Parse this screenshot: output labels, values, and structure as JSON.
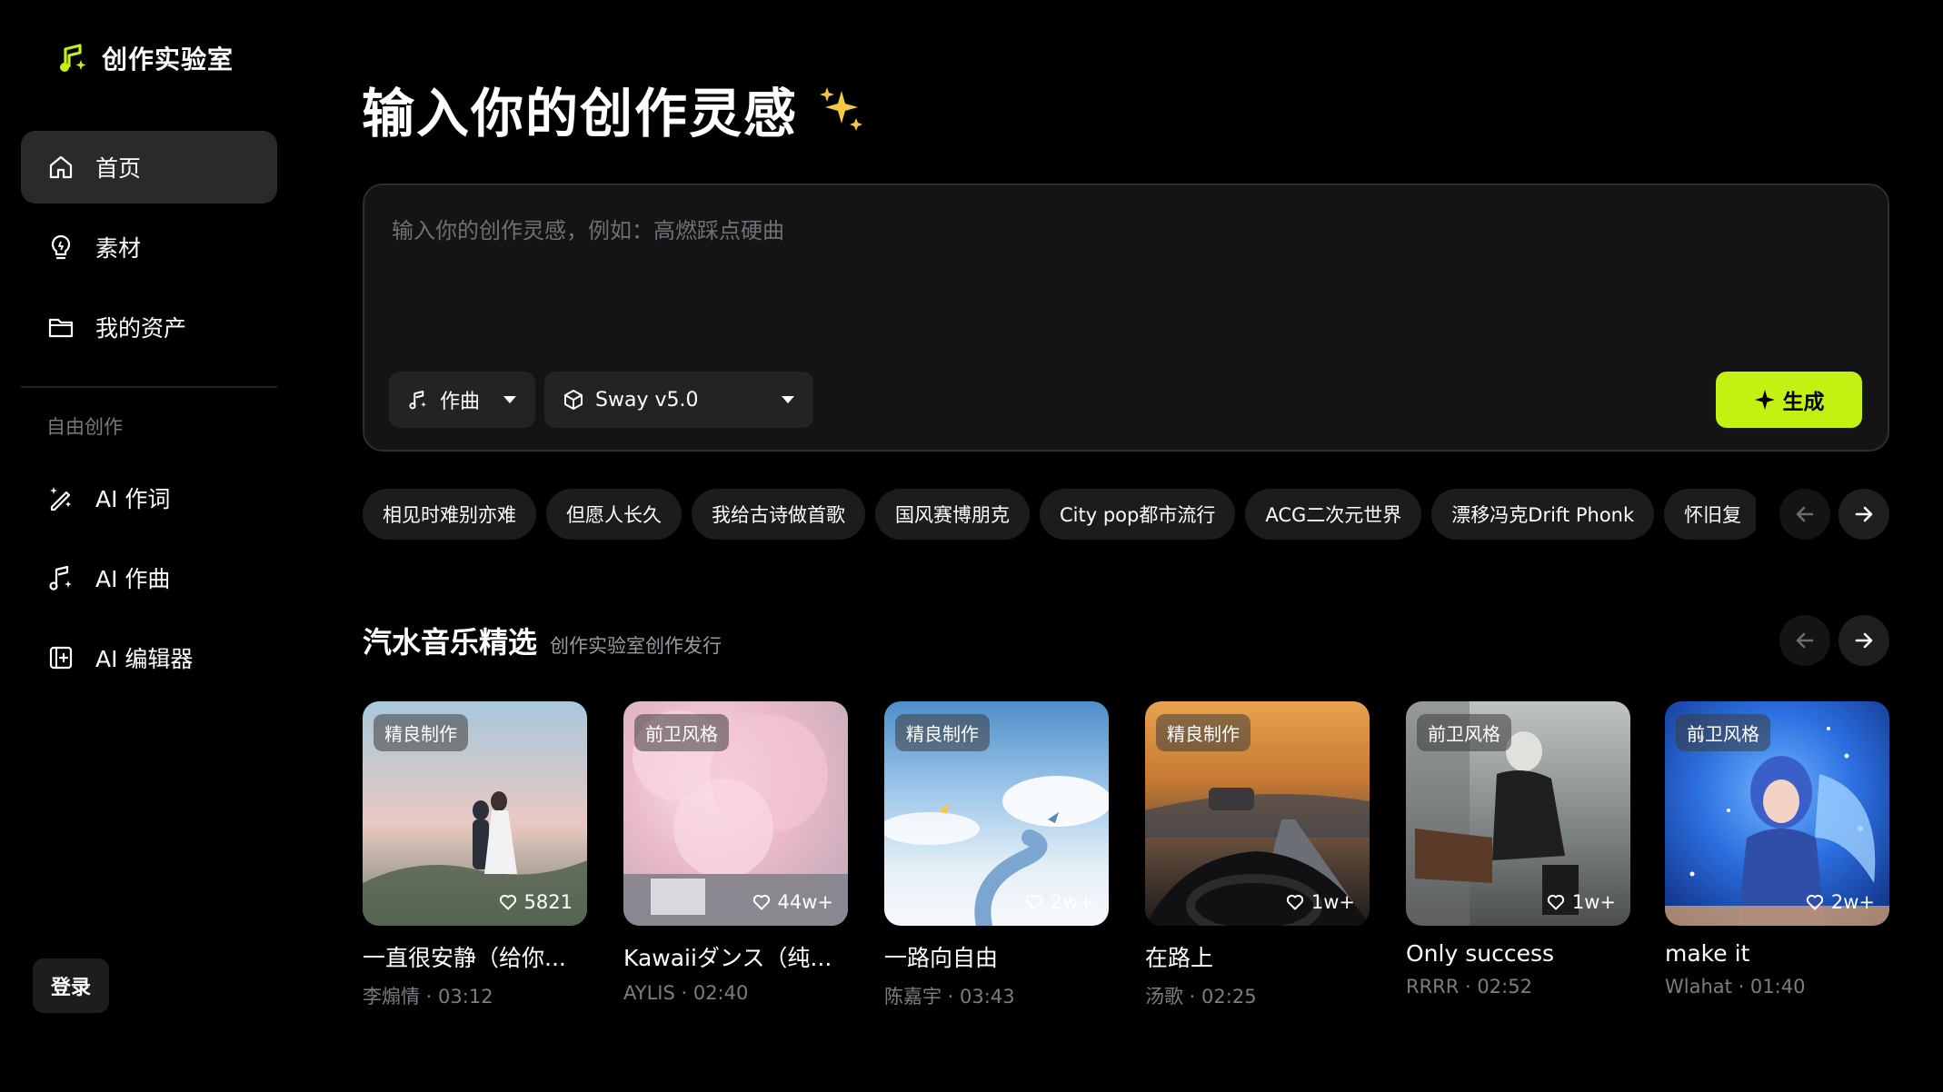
{
  "app": {
    "name": "创作实验室"
  },
  "sidebar": {
    "items": [
      {
        "label": "首页",
        "icon": "home-icon",
        "active": true
      },
      {
        "label": "素材",
        "icon": "bulb-icon",
        "active": false
      },
      {
        "label": "我的资产",
        "icon": "folder-icon",
        "active": false
      }
    ],
    "section_label": "自由创作",
    "tools": [
      {
        "label": "AI 作词",
        "icon": "magic-pen-icon"
      },
      {
        "label": "AI 作曲",
        "icon": "music-note-icon"
      },
      {
        "label": "AI 编辑器",
        "icon": "editor-icon"
      }
    ],
    "login_label": "登录"
  },
  "hero": {
    "title": "输入你的创作灵感",
    "sparkle": "sparkles-icon"
  },
  "composer": {
    "placeholder": "输入你的创作灵感，例如：高燃踩点硬曲",
    "value": "",
    "mode_select": "作曲",
    "model_select": "Sway v5.0",
    "generate_label": "生成"
  },
  "chips": [
    "相见时难别亦难",
    "但愿人长久",
    "我给古诗做首歌",
    "国风赛博朋克",
    "City pop都市流行",
    "ACG二次元世界",
    "漂移冯克Drift Phonk",
    "怀旧复"
  ],
  "featured": {
    "title": "汽水音乐精选",
    "subtitle": "创作实验室创作发行",
    "cards": [
      {
        "tag": "精良制作",
        "likes": "5821",
        "title": "一直很安静（给你...",
        "artist": "李煽情",
        "duration": "03:12"
      },
      {
        "tag": "前卫风格",
        "likes": "44w+",
        "title": "Kawaiiダンス（纯...",
        "artist": "AYLIS",
        "duration": "02:40"
      },
      {
        "tag": "精良制作",
        "likes": "2w+",
        "title": "一路向自由",
        "artist": "陈嘉宇",
        "duration": "03:43"
      },
      {
        "tag": "精良制作",
        "likes": "1w+",
        "title": "在路上",
        "artist": "汤歌",
        "duration": "02:25"
      },
      {
        "tag": "前卫风格",
        "likes": "1w+",
        "title": "Only success",
        "artist": "RRRR",
        "duration": "02:52"
      },
      {
        "tag": "前卫风格",
        "likes": "2w+",
        "title": "make it",
        "artist": "Wlahat",
        "duration": "01:40"
      }
    ]
  },
  "colors": {
    "accent": "#c4f112",
    "background": "#000000",
    "panel": "#141416",
    "chip": "#1c1c1f"
  }
}
